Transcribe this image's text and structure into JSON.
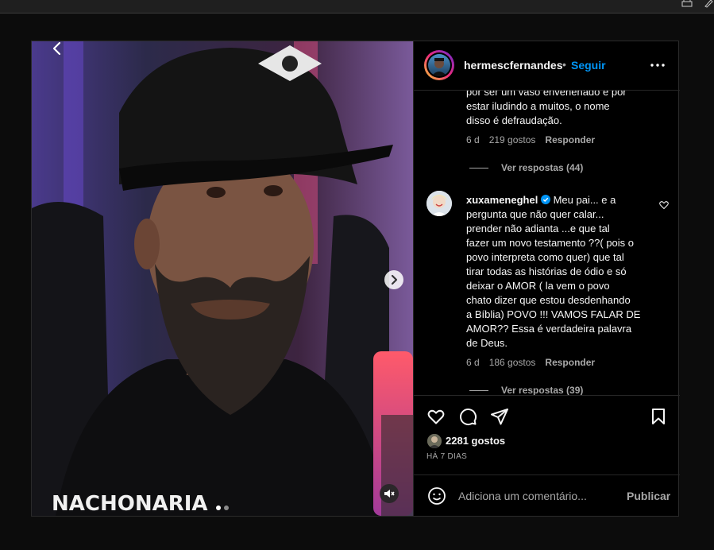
{
  "browser": {
    "icons": [
      "print-icon",
      "edit-icon"
    ]
  },
  "post": {
    "username": "hermescfernandes",
    "separator": "•",
    "follow_label": "Seguir",
    "likes": "2281 gostos",
    "time_ago": "HÁ 7 DIAS",
    "media": {
      "carousel_count": 2,
      "active_index": 0,
      "cap_text": "NACHONARIA"
    }
  },
  "comments": [
    {
      "text_lines": [
        "por ser um vaso envenenado e por",
        "estar iludindo a muitos, o nome",
        "disso é defraudação."
      ],
      "age": "6 d",
      "likes": "219 gostos",
      "reply_label": "Responder",
      "view_replies": "Ver respostas (44)"
    },
    {
      "user": "xuxameneghel",
      "verified": true,
      "text_lines": [
        "Meu pai... e a",
        "pergunta que não quer calar...",
        "prender não adianta ...e que tal",
        "fazer um novo testamento ??( pois o",
        "povo interpreta como quer) que tal",
        "tirar todas as histórias de ódio e só",
        "deixar o AMOR ( la vem o povo",
        "chato dizer que estou desdenhando",
        "a Bíblia) POVO !!! VAMOS FALAR DE",
        "AMOR?? Essa é verdadeira palavra",
        "de Deus."
      ],
      "age": "6 d",
      "likes": "186 gostos",
      "reply_label": "Responder",
      "view_replies": "Ver respostas (39)"
    }
  ],
  "composer": {
    "placeholder": "Adiciona um comentário...",
    "publish_label": "Publicar"
  },
  "colors": {
    "link": "#0095f6",
    "muted": "#a8a8a8",
    "background": "#000000",
    "border": "#262626"
  }
}
